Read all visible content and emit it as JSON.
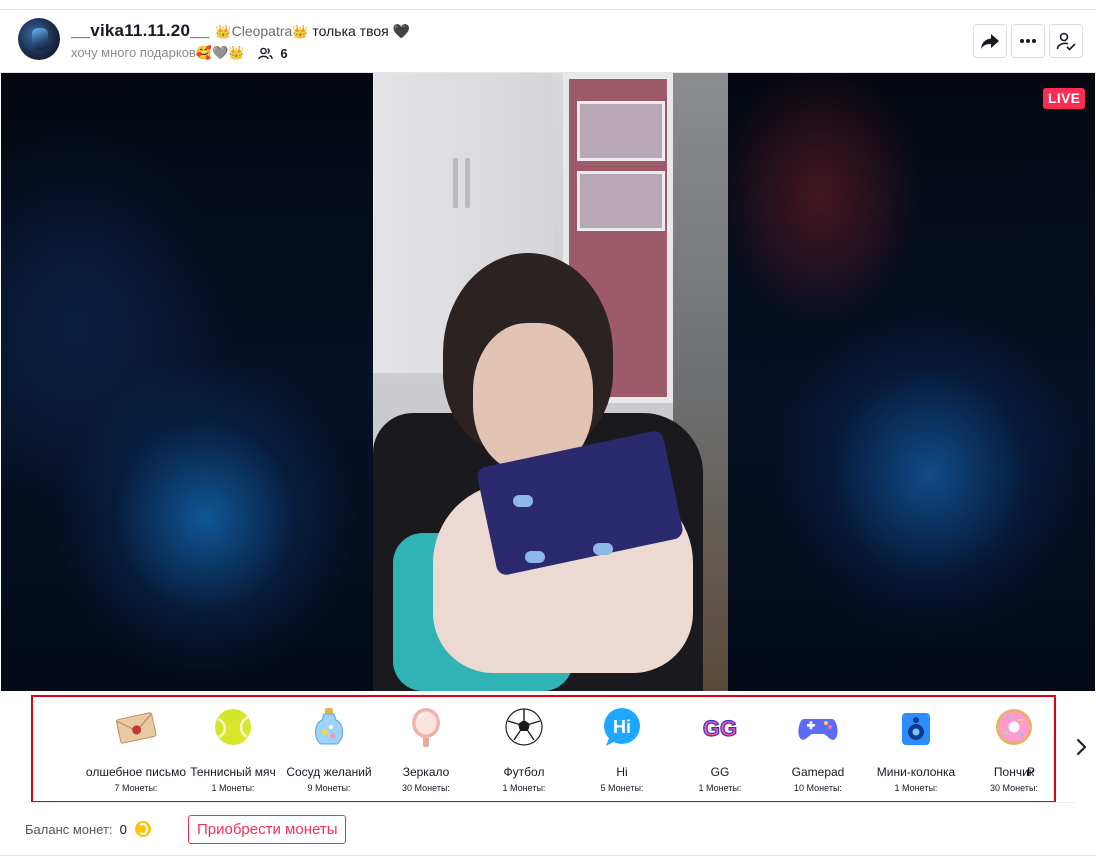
{
  "header": {
    "username": "__vika11.11.20__",
    "nickname_crown_left": "👑",
    "nickname_name": "Cleopatra",
    "nickname_crown_right": "👑",
    "nickname_tail": " толька твоя 🖤",
    "bio": "хочу много подарков🥰🩶👑",
    "viewer_count": "6",
    "icons": {
      "share": "share-icon",
      "more": "more-icon",
      "follow": "follow-icon",
      "viewers": "viewers-icon"
    }
  },
  "video": {
    "live_badge": "LIVE"
  },
  "gifts": [
    {
      "name": "олшебное письмо",
      "price": "7 Монеты:",
      "icon": "envelope-icon"
    },
    {
      "name": "Теннисный мяч",
      "price": "1 Монеты:",
      "icon": "tennis-ball-icon"
    },
    {
      "name": "Сосуд желаний",
      "price": "9 Монеты:",
      "icon": "wish-bottle-icon"
    },
    {
      "name": "Зеркало",
      "price": "30 Монеты:",
      "icon": "mirror-icon"
    },
    {
      "name": "Футбол",
      "price": "1 Монеты:",
      "icon": "soccer-ball-icon"
    },
    {
      "name": "Hi",
      "price": "5 Монеты:",
      "icon": "hi-bubble-icon"
    },
    {
      "name": "GG",
      "price": "1 Монеты:",
      "icon": "gg-icon"
    },
    {
      "name": "Gamepad",
      "price": "10 Монеты:",
      "icon": "gamepad-icon"
    },
    {
      "name": "Мини-колонка",
      "price": "1 Монеты:",
      "icon": "mini-speaker-icon"
    },
    {
      "name": "Пончик",
      "price": "30 Монеты:",
      "icon": "donut-icon"
    },
    {
      "name": "Р",
      "price": "",
      "icon": ""
    }
  ],
  "balance": {
    "label": "Баланс монет:",
    "value": "0",
    "buy_label": "Приобрести монеты",
    "coin_icon": "coin-icon"
  },
  "colors": {
    "accent": "#fe2c55",
    "highlight_border": "#e0000f"
  }
}
